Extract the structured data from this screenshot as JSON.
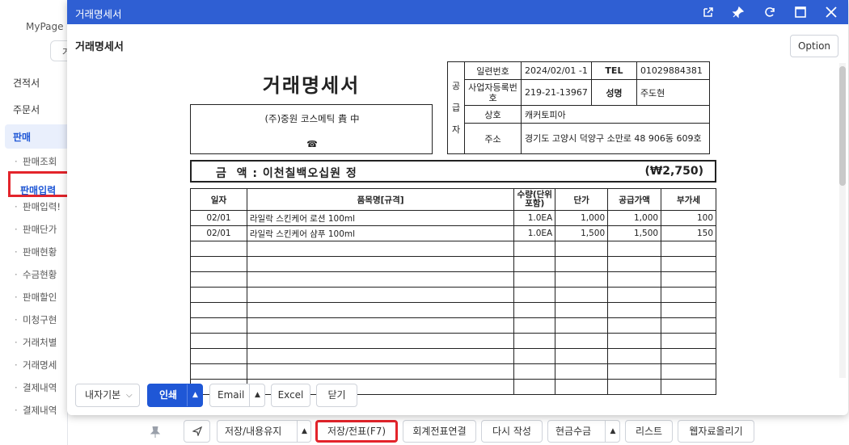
{
  "background": {
    "mypage_label": "MyPage",
    "mypage_tab_char": "거",
    "nav": {
      "quote": "견적서",
      "order": "주문서",
      "sales_group": "판매",
      "sub_items": [
        "판매조회",
        "판매입력",
        "판매입력!",
        "판매단가",
        "판매현황",
        "수금현황",
        "판매할인",
        "미청구현",
        "거래처별",
        "거래명세",
        "결제내역",
        "결제내역"
      ]
    },
    "bottom_toolbar": {
      "send": "",
      "save_keep": "저장/내용유지",
      "save_slip": "저장/전표(F7)",
      "link_slip": "회계전표연결",
      "rewrite": "다시 작성",
      "cash_receipt": "현금수금",
      "list": "리스트",
      "web_upload": "웹자료올리기"
    }
  },
  "modal": {
    "window_title": "거래명세서",
    "sub_title": "거래명세서",
    "option_button": "Option",
    "icons": [
      "external-link-icon",
      "pin-icon",
      "refresh-icon",
      "maximize-icon",
      "close-icon"
    ],
    "footer": {
      "layout_select": "내자기본",
      "print": "인쇄",
      "email": "Email",
      "excel": "Excel",
      "close": "닫기"
    }
  },
  "invoice": {
    "title": "거래명세서",
    "buyer": {
      "name": "(주)중원 코스메틱 貴 中",
      "phone_symbol": "☎"
    },
    "supplier_vertical": [
      "공",
      "급",
      "자"
    ],
    "supplier": {
      "serial_label": "일련번호",
      "serial_value": "2024/02/01 -1",
      "tel_label": "TEL",
      "tel_value": "01029884381",
      "bizno_label": "사업자등록번호",
      "bizno_value": "219-21-13967",
      "owner_label": "성명",
      "owner_value": "주도현",
      "company_label": "상호",
      "company_value": "캐커토피아",
      "address_label": "주소",
      "address_value": "경기도 고양시 덕양구 소만로 48 906동 609호"
    },
    "amount": {
      "text": "금  액 : 이천칠백오십원 정",
      "value": "(₩2,750)"
    },
    "table": {
      "headers": [
        "일자",
        "품목명[규격]",
        "수량(단위포함)",
        "단가",
        "공급가액",
        "부가세"
      ],
      "rows": [
        [
          "02/01",
          "라일락 스킨케어 로션 100ml",
          "1.0EA",
          "1,000",
          "1,000",
          "100"
        ],
        [
          "02/01",
          "라일락 스킨케어 샴푸 100ml",
          "1.0EA",
          "1,500",
          "1,500",
          "150"
        ]
      ],
      "empty_rows": 10
    }
  },
  "colors": {
    "header_blue": "#2f5fd3",
    "print_blue": "#1f57d6",
    "highlight_red": "#e3242b"
  }
}
